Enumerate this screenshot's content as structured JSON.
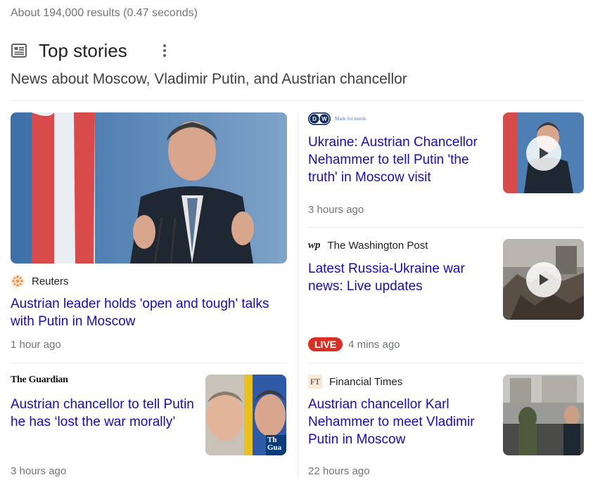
{
  "results_stats": "About 194,000 results (0.47 seconds)",
  "section": {
    "title": "Top stories",
    "subtitle": "News about Moscow, Vladimir Putin, and Austrian chancellor",
    "icon": "newspaper-icon",
    "menu_icon": "more-vert-icon"
  },
  "stories": [
    {
      "source": "Reuters",
      "headline": "Austrian leader holds 'open and tough' talks with Putin in Moscow",
      "time": "1 hour ago"
    },
    {
      "source_logo_text": "DW",
      "source_tagline": "Made for minds",
      "headline": "Ukraine: Austrian Chancellor Nehammer to tell Putin 'the truth' in Moscow visit",
      "time": "3 hours ago",
      "has_video": true
    },
    {
      "source_logo_text": "wp",
      "source": "The Washington Post",
      "headline": "Latest Russia-Ukraine war news: Live updates",
      "live_label": "LIVE",
      "time": "4 mins ago",
      "has_video": true
    },
    {
      "source_logo_text": "The Guardian",
      "headline": "Austrian chancellor to tell Putin he has ‘lost the war morally’",
      "time": "3 hours ago",
      "thumb_text": "Th Gua"
    },
    {
      "source_logo_text": "FT",
      "source": "Financial Times",
      "headline": "Austrian chancellor Karl Nehammer to meet Vladimir Putin in Moscow",
      "time": "22 hours ago"
    }
  ],
  "colors": {
    "link": "#1a0dab",
    "meta": "#70757a",
    "live": "#d93025",
    "divider": "#ebebeb"
  }
}
